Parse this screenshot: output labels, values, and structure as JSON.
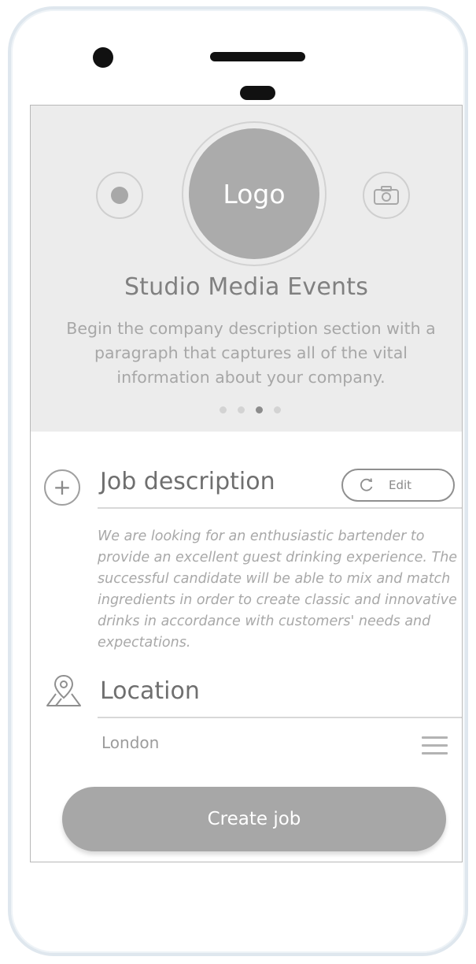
{
  "hero": {
    "logo_label": "Logo",
    "company_name": "Studio Media Events",
    "description": "Begin the company description section with a paragraph that captures all of the vital information about your company.",
    "pager": {
      "count": 4,
      "active_index": 2
    },
    "left_icon": "record-icon",
    "right_icon": "camera-icon"
  },
  "job": {
    "title": "Job description",
    "edit_label": "Edit",
    "edit_icon": "refresh-icon",
    "add_icon": "plus-icon",
    "text": "We are looking for an enthusiastic bartender to provide an excellent guest drinking experience. The successful candidate will be able to mix and match ingredients in order to create classic and innovative drinks in accordance with customers' needs and expectations."
  },
  "location": {
    "title": "Location",
    "icon": "map-pin-icon",
    "value": "London",
    "menu_icon": "hamburger-icon"
  },
  "actions": {
    "create_label": "Create job"
  }
}
